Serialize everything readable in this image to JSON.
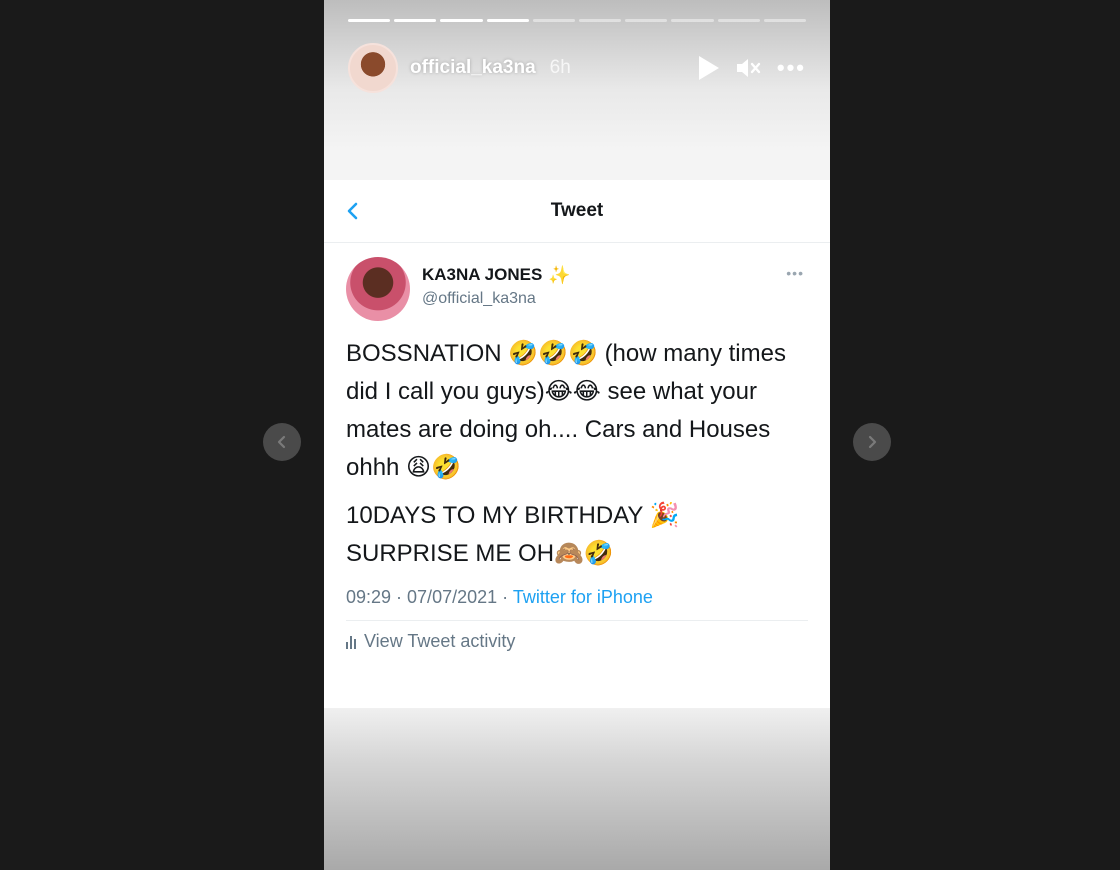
{
  "story": {
    "progress_segments": 10,
    "progress_completed": 4,
    "username": "official_ka3na",
    "time_ago": "6h"
  },
  "tweet": {
    "header_title": "Tweet",
    "author_name": "KA3NA JONES",
    "author_handle": "@official_ka3na",
    "paragraphs": [
      "BOSSNATION 🤣🤣🤣 (how many times did I call you guys)😂😂 see what your mates are doing oh.... Cars and Houses ohhh 😩🤣",
      "10DAYS TO MY BIRTHDAY 🎉 SURPRISE ME OH🙈🤣"
    ],
    "timestamp": "09:29 · 07/07/2021 · ",
    "source": "Twitter for iPhone",
    "activity_label": "View Tweet activity"
  },
  "colors": {
    "accent": "#1da1f2",
    "page_background": "#1a1a1a",
    "secondary_text": "#657786"
  },
  "icons": [
    "play-icon",
    "mute-icon",
    "more-icon",
    "back-icon",
    "sparkle-icon",
    "kebab-icon",
    "bar-chart-icon",
    "chevron-left-icon",
    "chevron-right-icon"
  ]
}
